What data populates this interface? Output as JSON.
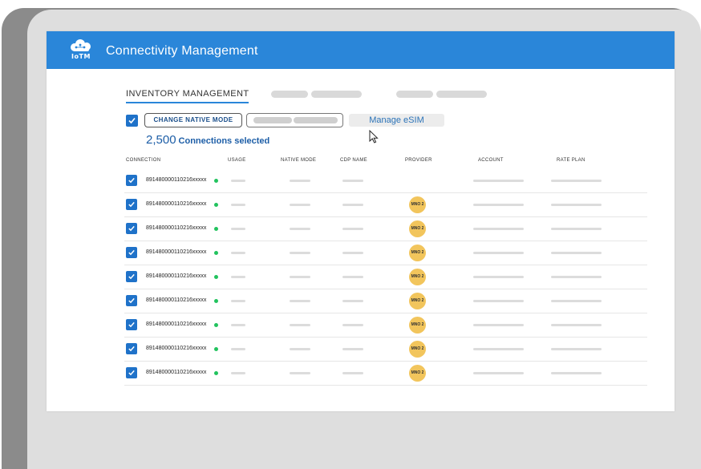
{
  "app": {
    "title": "Connectivity Management",
    "logo_text": "IoTM",
    "brand_color": "#2a86d9"
  },
  "tabs": {
    "active_label": "INVENTORY MANAGEMENT"
  },
  "toolbar": {
    "change_native_mode_label": "CHANGE NATIVE MODE",
    "manage_esim_label": "Manage eSIM",
    "selected_count": "2,500",
    "selected_label": "Connections selected"
  },
  "table": {
    "columns": [
      "CONNECTION",
      "USAGE",
      "NATIVE MODE",
      "CDP NAME",
      "PROVIDER",
      "ACCOUNT",
      "RATE PLAN"
    ],
    "rows": [
      {
        "iccid": "891480000110216xxxxx",
        "provider": "",
        "status": "active"
      },
      {
        "iccid": "891480000110216xxxxx",
        "provider": "MNO 2",
        "status": "active"
      },
      {
        "iccid": "891480000110216xxxxx",
        "provider": "MNO 2",
        "status": "active"
      },
      {
        "iccid": "891480000110216xxxxx",
        "provider": "MNO 2",
        "status": "active"
      },
      {
        "iccid": "891480000110216xxxxx",
        "provider": "MNO 2",
        "status": "active"
      },
      {
        "iccid": "891480000110216xxxxx",
        "provider": "MNO 2",
        "status": "active"
      },
      {
        "iccid": "891480000110216xxxxx",
        "provider": "MNO 2",
        "status": "active"
      },
      {
        "iccid": "891480000110216xxxxx",
        "provider": "MNO 2",
        "status": "active"
      },
      {
        "iccid": "891480000110216xxxxx",
        "provider": "MNO 2",
        "status": "active"
      }
    ]
  },
  "colors": {
    "checkbox": "#1f72c9",
    "status_active": "#22c35e",
    "provider_badge": "#f2c55c",
    "selected_text": "#1d5ea7"
  },
  "icons": {
    "logo": "cloud-logo-icon",
    "checkbox": "checkmark-icon",
    "cursor": "mouse-pointer-icon"
  }
}
